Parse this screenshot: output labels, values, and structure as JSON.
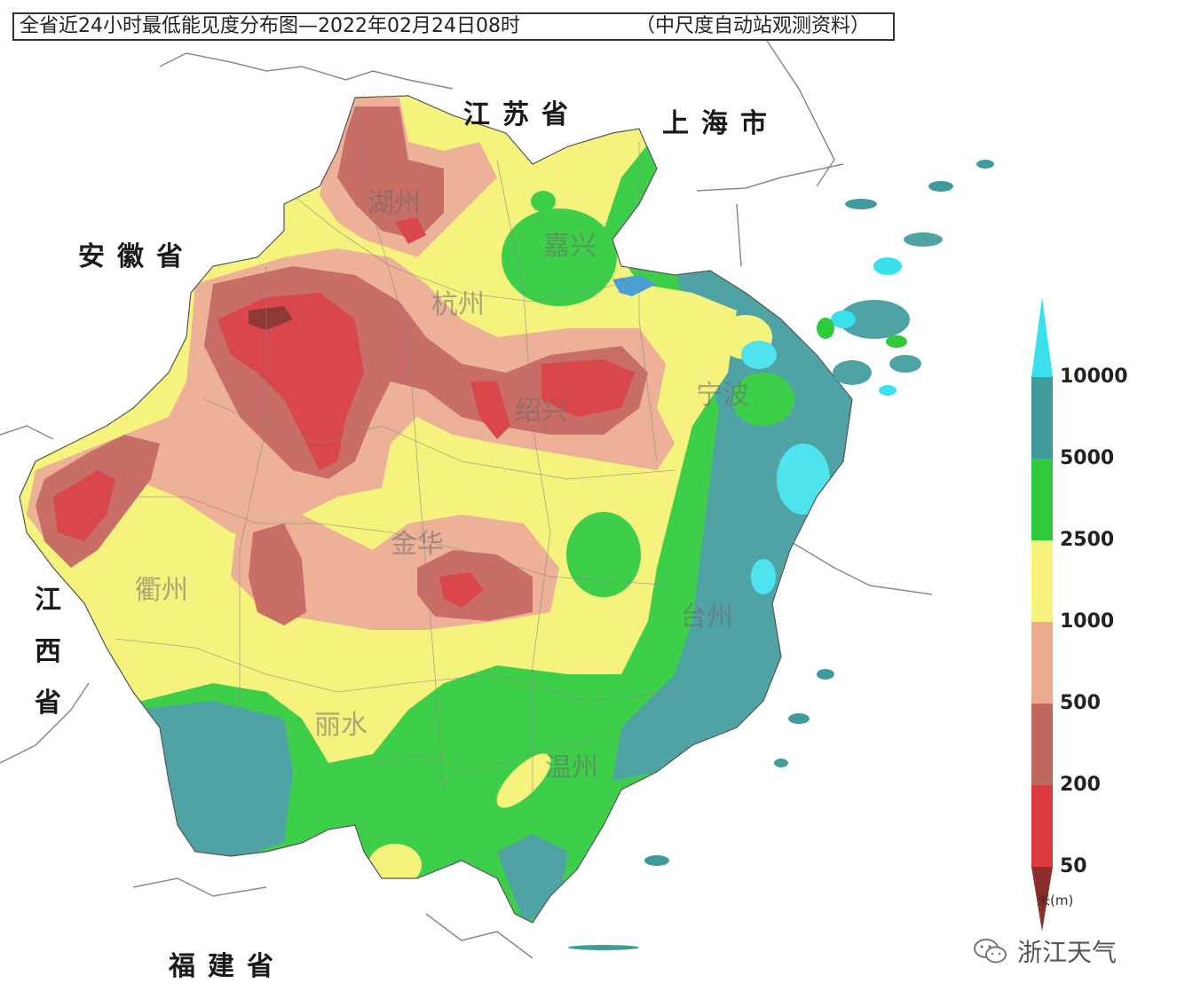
{
  "title": {
    "main": "全省近24小时最低能见度分布图—2022年02月24日08时",
    "source": "（中尺度自动站观测资料）"
  },
  "provinces": {
    "jiangsu": "江苏省",
    "shanghai": "上海市",
    "anhui": "安徽省",
    "jiangxi": [
      "江",
      "西",
      "省"
    ],
    "fujian": "福建省"
  },
  "cities": {
    "huzhou": "湖州",
    "jiaxing": "嘉兴",
    "hangzhou": "杭州",
    "shaoxing": "绍兴",
    "ningbo": "宁波",
    "jinhua": "金华",
    "quzhou": "衢州",
    "taizhou": "台州",
    "lishui": "丽水",
    "wenzhou": "温州"
  },
  "legend": {
    "labels": [
      "10000",
      "5000",
      "2500",
      "1000",
      "500",
      "200",
      "50"
    ],
    "unit": "米(m)",
    "colors": [
      "#3ae0ec",
      "#3f9b9c",
      "#2fca3c",
      "#f7f37c",
      "#eeaa8d",
      "#c26660",
      "#dd3a3e",
      "#8c2f2c"
    ]
  },
  "colors": {
    "teal": "#4fa3a5",
    "green": "#3dce4a",
    "yellow": "#f6f27e",
    "salmon": "#ecb196",
    "brownred": "#c96e66",
    "red": "#d9474b",
    "darkred": "#8e3838",
    "cyan": "#4fe3ef"
  },
  "watermark": {
    "text": "浙江天气",
    "icon": "wechat-icon"
  }
}
